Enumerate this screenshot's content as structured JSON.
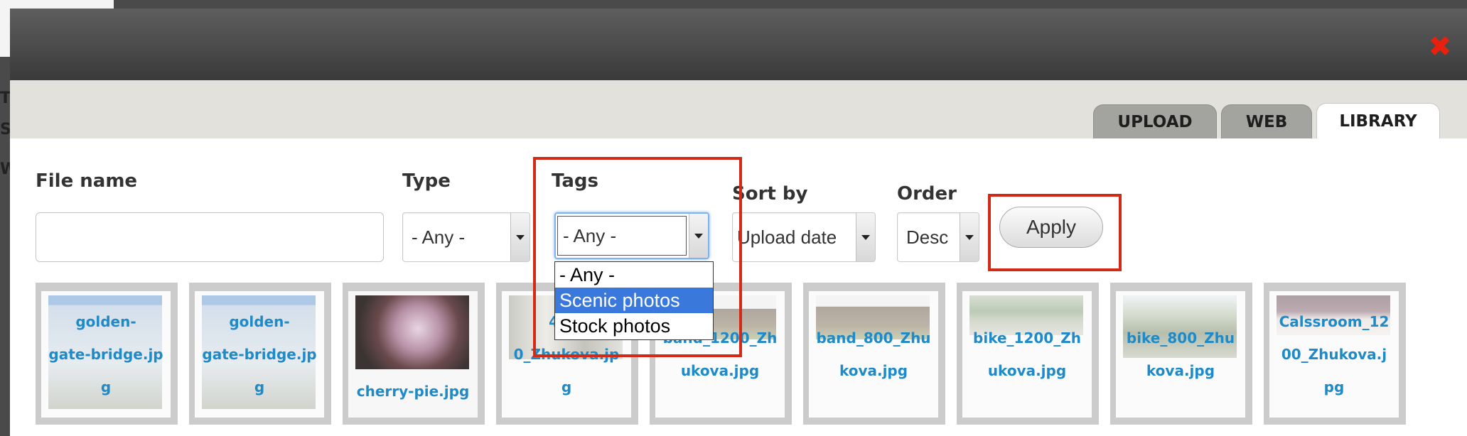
{
  "background": {
    "chars": [
      "T",
      "S",
      "W"
    ]
  },
  "modal": {
    "close_label": "✖",
    "tabs": [
      {
        "label": "UPLOAD",
        "active": false
      },
      {
        "label": "WEB",
        "active": false
      },
      {
        "label": "LIBRARY",
        "active": true
      }
    ]
  },
  "filters": {
    "file_name": {
      "label": "File name",
      "value": ""
    },
    "type": {
      "label": "Type",
      "selected": "- Any -"
    },
    "tags": {
      "label": "Tags",
      "selected": "- Any -",
      "options": [
        "- Any -",
        "Scenic photos",
        "Stock photos"
      ],
      "highlighted": "Scenic photos"
    },
    "sort_by": {
      "label": "Sort by",
      "selected": "Upload date"
    },
    "order": {
      "label": "Order",
      "selected": "Desc"
    },
    "apply_label": "Apply"
  },
  "thumbnails": [
    {
      "lines": [
        "golden-",
        "gate-bridge.jp",
        "g"
      ]
    },
    {
      "lines": [
        "golden-",
        "gate-bridge.jp",
        "g"
      ]
    },
    {
      "lines": [
        "cherry-pie.jpg"
      ]
    },
    {
      "lines": [
        "4stu",
        "0_Zhukova.jp",
        "g"
      ]
    },
    {
      "lines": [
        "band_1200_Zh",
        "ukova.jpg"
      ]
    },
    {
      "lines": [
        "band_800_Zhu",
        "kova.jpg"
      ]
    },
    {
      "lines": [
        "bike_1200_Zh",
        "ukova.jpg"
      ]
    },
    {
      "lines": [
        "bike_800_Zhu",
        "kova.jpg"
      ]
    },
    {
      "lines": [
        "Calssroom_12",
        "00_Zhukova.j",
        "pg"
      ]
    }
  ],
  "colors": {
    "highlight": "#d22a16",
    "link": "#1f8ac8",
    "selected_option": "#3b78db"
  }
}
